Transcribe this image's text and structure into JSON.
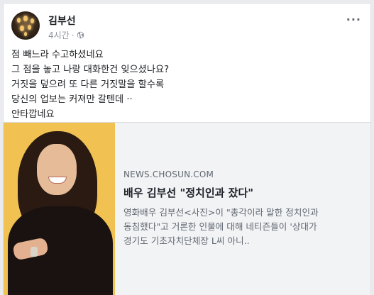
{
  "post": {
    "author": "김부선",
    "time": "4시간",
    "privacy_icon": "globe-icon",
    "more_icon": "more-options-icon",
    "more_label": "···",
    "lines": [
      "점 빼느라 수고하셨네요",
      "그 점을 놓고 나랑 대화한건 잊으셨나요?",
      "거짓을 덮으려 또 다른 거짓말을 할수록",
      "당신의 업보는 커져만 갈텐데 ··",
      "안타깝네요"
    ]
  },
  "link": {
    "domain": "NEWS.CHOSUN.COM",
    "headline": "배우 김부선 \"정치인과 잤다\"",
    "description_lines": [
      "영화배우 김부선<사진>이 \"총각이라 말한 정치인과",
      "동침했다\"고 거론한 인물에 대해 네티즌들이 '상대가",
      "경기도 기초자치단체장 L씨 아니.."
    ]
  },
  "colors": {
    "page_bg": "#e9ebee",
    "card_bg": "#ffffff",
    "link_bg": "#f2f3f5",
    "meta_text": "#90949c",
    "thumb_bg": "#f1c252"
  }
}
